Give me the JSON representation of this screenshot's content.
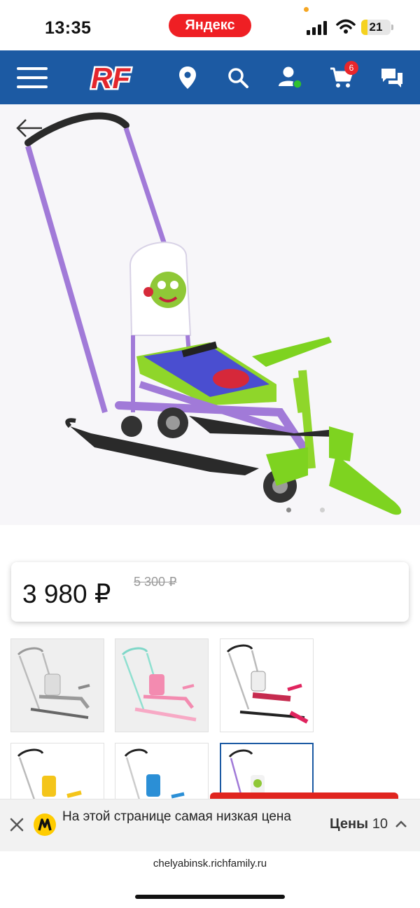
{
  "status_bar": {
    "time": "13:35",
    "browser_label": "Яндекс",
    "battery": "21",
    "battery_level": 0.21
  },
  "header": {
    "logo_text": "RF",
    "cart_count": "6",
    "icons": [
      "menu-icon",
      "location-pin-icon",
      "search-icon",
      "user-icon",
      "cart-icon",
      "chat-icon"
    ],
    "brand_color": "#1c5aa3"
  },
  "product": {
    "price_current": "3 980 ₽",
    "price_old": "5 300 ₽",
    "carousel_pages": 2,
    "carousel_active": 1
  },
  "thumbnails": [
    {
      "color": "#9a9a9a"
    },
    {
      "color": "#f38bb0"
    },
    {
      "color": "#e0245e"
    },
    {
      "color": "#f4c51a"
    },
    {
      "color": "#2b8fd6"
    },
    {
      "color": "#9b79d6"
    }
  ],
  "price_bar": {
    "text": "На этой странице самая низкая цена",
    "prices_label": "Цены",
    "prices_count": "10"
  },
  "url_bar": {
    "url": "chelyabinsk.richfamily.ru"
  },
  "colors": {
    "accent_red": "#e0251f",
    "brand_blue": "#1c5aa3"
  }
}
